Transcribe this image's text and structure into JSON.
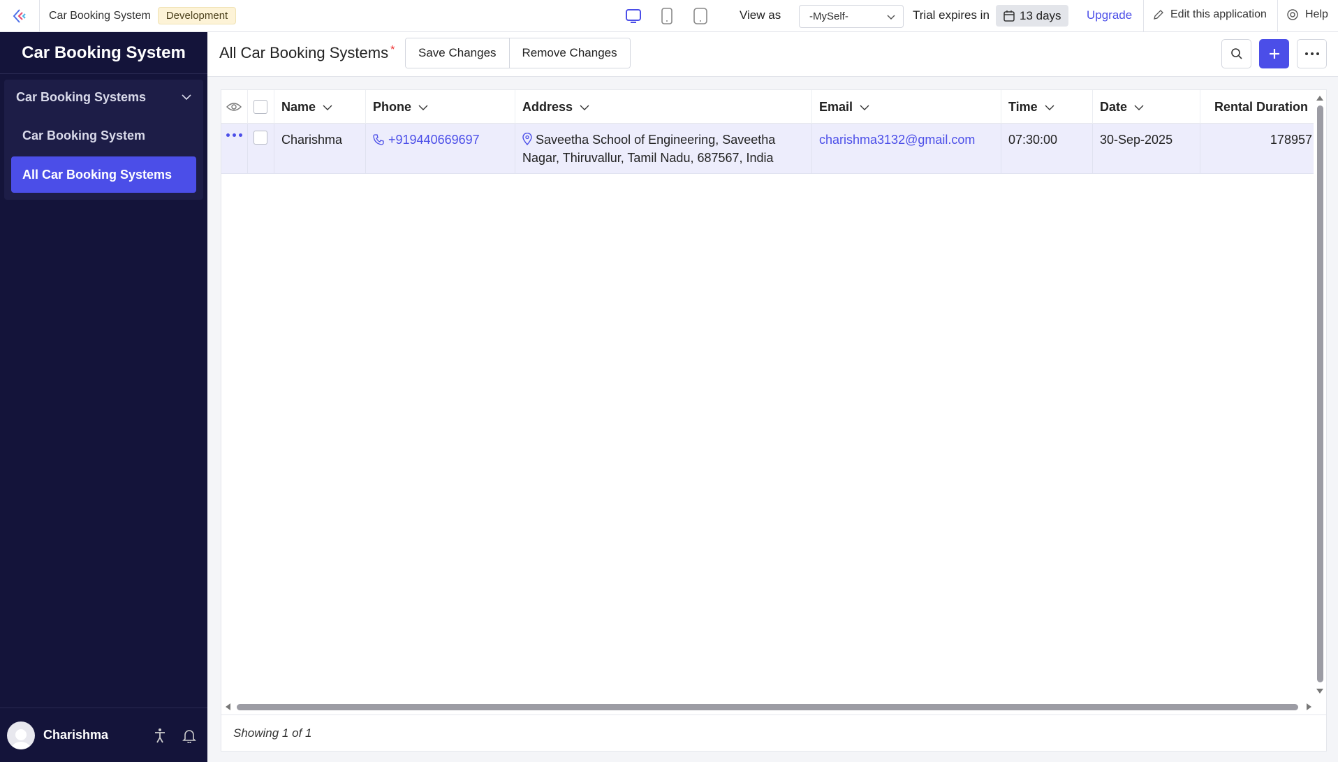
{
  "topbar": {
    "app_name": "Car Booking System",
    "env_badge": "Development",
    "view_as_label": "View as",
    "view_as_value": "-MySelf-",
    "trial_label": "Trial expires in",
    "trial_days": "13 days",
    "upgrade_label": "Upgrade",
    "edit_label": "Edit this application",
    "help_label": "Help"
  },
  "sidebar": {
    "title": "Car Booking System",
    "group_label": "Car Booking Systems",
    "items": [
      {
        "label": "Car Booking System"
      },
      {
        "label": "All Car Booking Systems"
      }
    ],
    "user_name": "Charishma"
  },
  "header": {
    "title": "All Car Booking Systems",
    "unsaved_marker": "*",
    "save_label": "Save Changes",
    "remove_label": "Remove Changes"
  },
  "table": {
    "columns": [
      "Name",
      "Phone",
      "Address",
      "Email",
      "Time",
      "Date",
      "Rental Duration"
    ],
    "rows": [
      {
        "name": "Charishma",
        "phone": "+919440669697",
        "address": "Saveetha School of Engineering, Saveetha Nagar, Thiruvallur, Tamil Nadu, 687567, India",
        "email": "charishma3132@gmail.com",
        "time": "07:30:00",
        "date": "30-Sep-2025",
        "rental_duration": "178957"
      }
    ],
    "footer": "Showing 1 of 1"
  },
  "colors": {
    "accent": "#4b4ee8",
    "sidebar_bg": "#14143a",
    "row_highlight": "#ededfc"
  }
}
